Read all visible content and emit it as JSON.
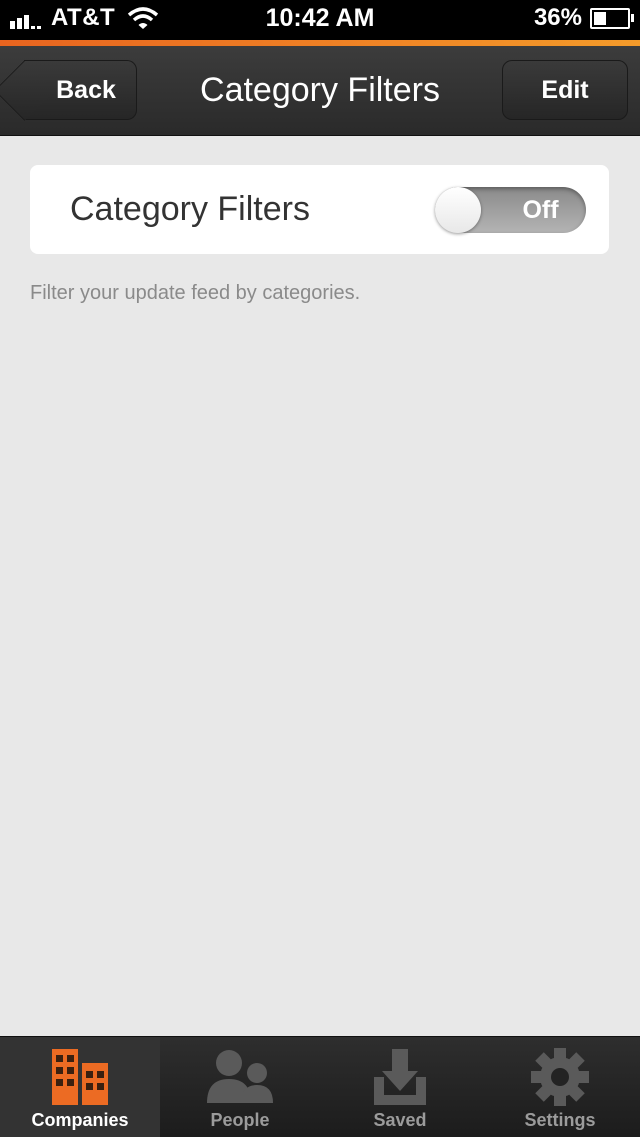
{
  "status_bar": {
    "carrier": "AT&T",
    "time": "10:42 AM",
    "battery_percent": "36%",
    "battery_level": 0.36
  },
  "nav": {
    "back_label": "Back",
    "title": "Category Filters",
    "edit_label": "Edit"
  },
  "settings": {
    "category_filters_label": "Category Filters",
    "toggle_state": "Off",
    "helper_text": "Filter your update feed by categories."
  },
  "tabs": [
    {
      "label": "Companies",
      "icon": "buildings-icon",
      "active": true
    },
    {
      "label": "People",
      "icon": "people-icon",
      "active": false
    },
    {
      "label": "Saved",
      "icon": "download-tray-icon",
      "active": false
    },
    {
      "label": "Settings",
      "icon": "gear-icon",
      "active": false
    }
  ],
  "colors": {
    "accent": "#e8641f",
    "background": "#e8e8e8",
    "nav_bar": "#333333"
  }
}
